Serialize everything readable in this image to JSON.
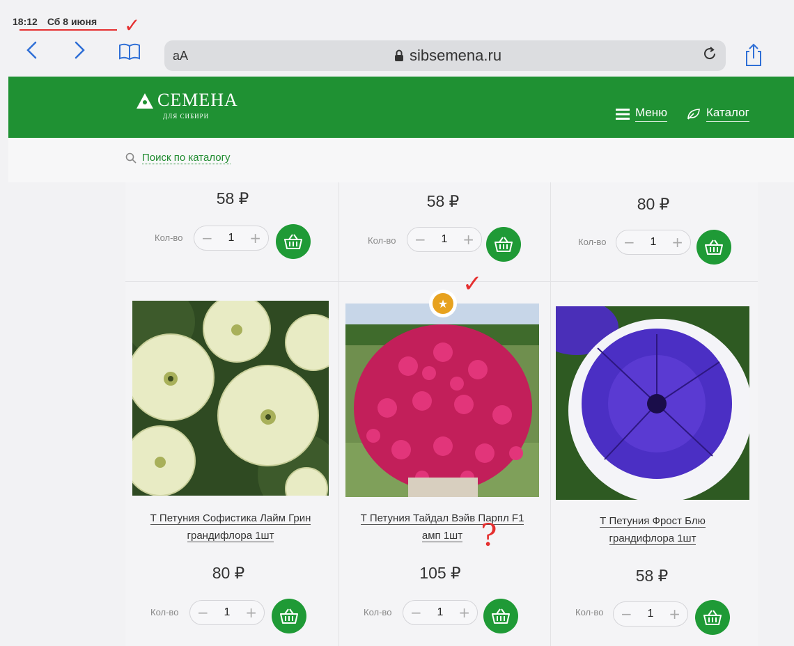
{
  "status_bar": {
    "time": "18:12",
    "date": "Сб 8 июня"
  },
  "browser": {
    "text_size_label": "аА",
    "url": "sibsemena.ru",
    "icons": [
      "back-icon",
      "forward-icon",
      "bookmarks-icon",
      "lock-icon",
      "reload-icon",
      "share-icon"
    ]
  },
  "site": {
    "logo_text": "СЕМЕНА",
    "logo_sub": "ДЛЯ СИБИРИ",
    "menu_label": "Меню",
    "catalog_label": "Каталог",
    "search_label": "Поиск по каталогу"
  },
  "qty_label": "Кол-во",
  "top_row": [
    {
      "price": "58 ₽",
      "qty": "1"
    },
    {
      "price": "58 ₽",
      "qty": "1"
    },
    {
      "price": "80 ₽",
      "qty": "1"
    }
  ],
  "products": [
    {
      "title_line1": "Т Петуния Софистика Лайм Грин",
      "title_line2": "грандифлора 1шт",
      "price": "80 ₽",
      "qty": "1"
    },
    {
      "title_line1": "Т Петуния Тайдал Вэйв Парпл F1",
      "title_line2": "амп 1шт",
      "price": "105 ₽",
      "qty": "1",
      "badge": "star-icon"
    },
    {
      "title_line1": "Т Петуния Фрост Блю",
      "title_line2": "грандифлора 1шт",
      "price": "58 ₽",
      "qty": "1"
    }
  ],
  "colors": {
    "brand_green": "#1f9133",
    "annotation_red": "#e53030",
    "badge_orange": "#e7a21f"
  }
}
